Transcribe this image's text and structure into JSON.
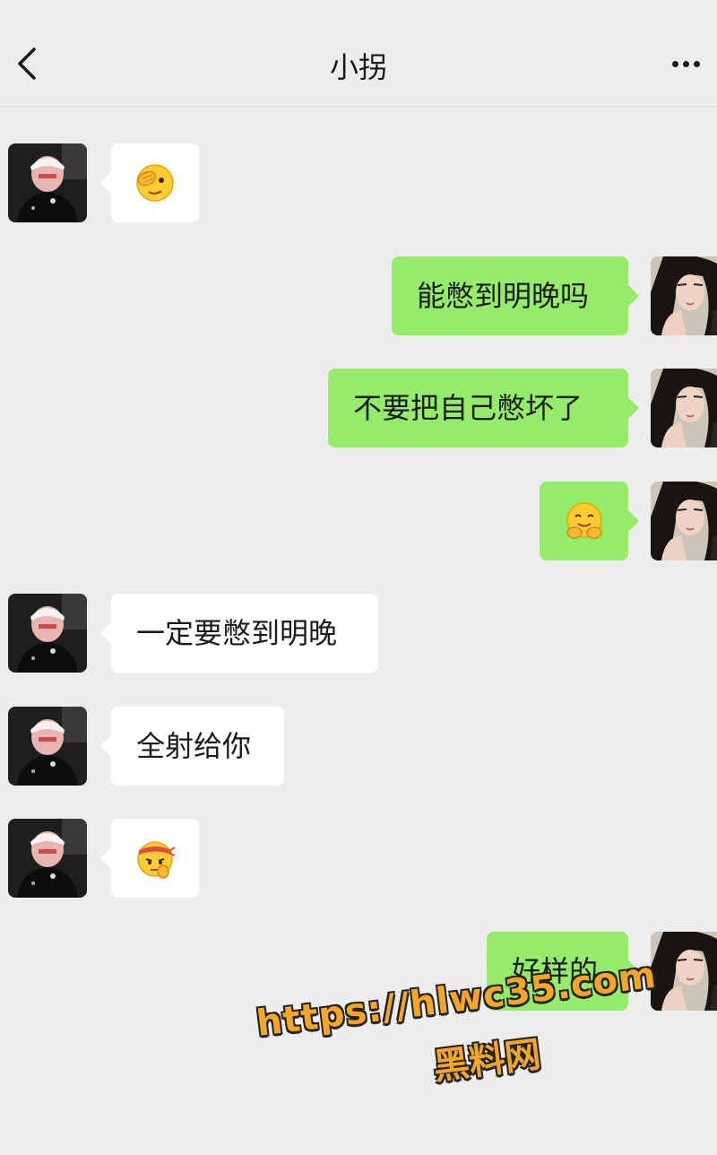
{
  "header": {
    "title": "小拐"
  },
  "messages": [
    {
      "side": "left",
      "kind": "emoji",
      "icon": "face-with-hand-over-eye-emoji"
    },
    {
      "side": "right",
      "kind": "text",
      "text": "能憋到明晚吗"
    },
    {
      "side": "right",
      "kind": "text",
      "text": "不要把自己憋坏了"
    },
    {
      "side": "right",
      "kind": "emoji",
      "icon": "hugging-face-emoji"
    },
    {
      "side": "left",
      "kind": "text",
      "text": "一定要憋到明晚"
    },
    {
      "side": "left",
      "kind": "text",
      "text": "全射给你"
    },
    {
      "side": "left",
      "kind": "emoji",
      "icon": "headband-determined-face-emoji"
    },
    {
      "side": "right",
      "kind": "text",
      "text": "好样的"
    }
  ],
  "watermark": {
    "url": "https://hlwc35.com",
    "label": "黑料网"
  },
  "colors": {
    "background": "#ededed",
    "outgoing_bubble": "#95ec69",
    "incoming_bubble": "#ffffff",
    "watermark": "#f5a623"
  }
}
